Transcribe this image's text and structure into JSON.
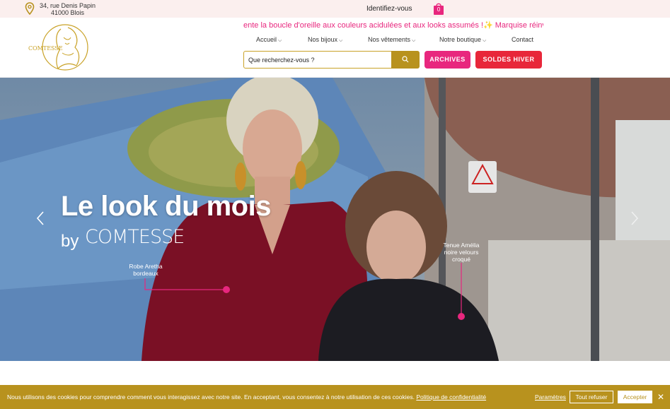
{
  "topbar": {
    "address_line1": "34, rue Denis Papin",
    "address_line2": "41000 Blois",
    "identify": "Identifiez-vous",
    "cart_count": "0",
    "icons": [
      "location-pin-icon",
      "shopping-bag-icon"
    ]
  },
  "header": {
    "logo_text": "COMTESSE",
    "ticker": "ente la boucle d'oreille aux couleurs acidulées et aux looks assumés !✨ Marquise réinvente la b",
    "nav": [
      {
        "label": "Accueil",
        "dropdown": true
      },
      {
        "label": "Nos bijoux",
        "dropdown": true
      },
      {
        "label": "Nos vêtements",
        "dropdown": true
      },
      {
        "label": "Notre boutique",
        "dropdown": true
      },
      {
        "label": "Contact",
        "dropdown": false
      }
    ],
    "search_placeholder": "Que recherchez-vous ?",
    "archives_label": "ARCHIVES",
    "soldes_label": "SOLDES HIVER"
  },
  "hero": {
    "title": "Le look du mois",
    "by": "by",
    "brand": "COMTESSE",
    "label_left": "Robe Aretha bordeaux",
    "label_right": "Tenue Amélia noire velours croqué"
  },
  "cookie": {
    "text": "Nous utilisons des cookies pour comprendre comment vous interagissez avec notre site. En acceptant, vous consentez à notre utilisation de ces cookies.",
    "policy_link": "Politique de confidentialité",
    "params": "Paramètres",
    "refuse": "Tout refuser",
    "accept": "Accepter"
  },
  "colors": {
    "pink": "#e8277e",
    "red": "#e8273a",
    "gold": "#b8921e",
    "topbar_bg": "#fbefee"
  }
}
